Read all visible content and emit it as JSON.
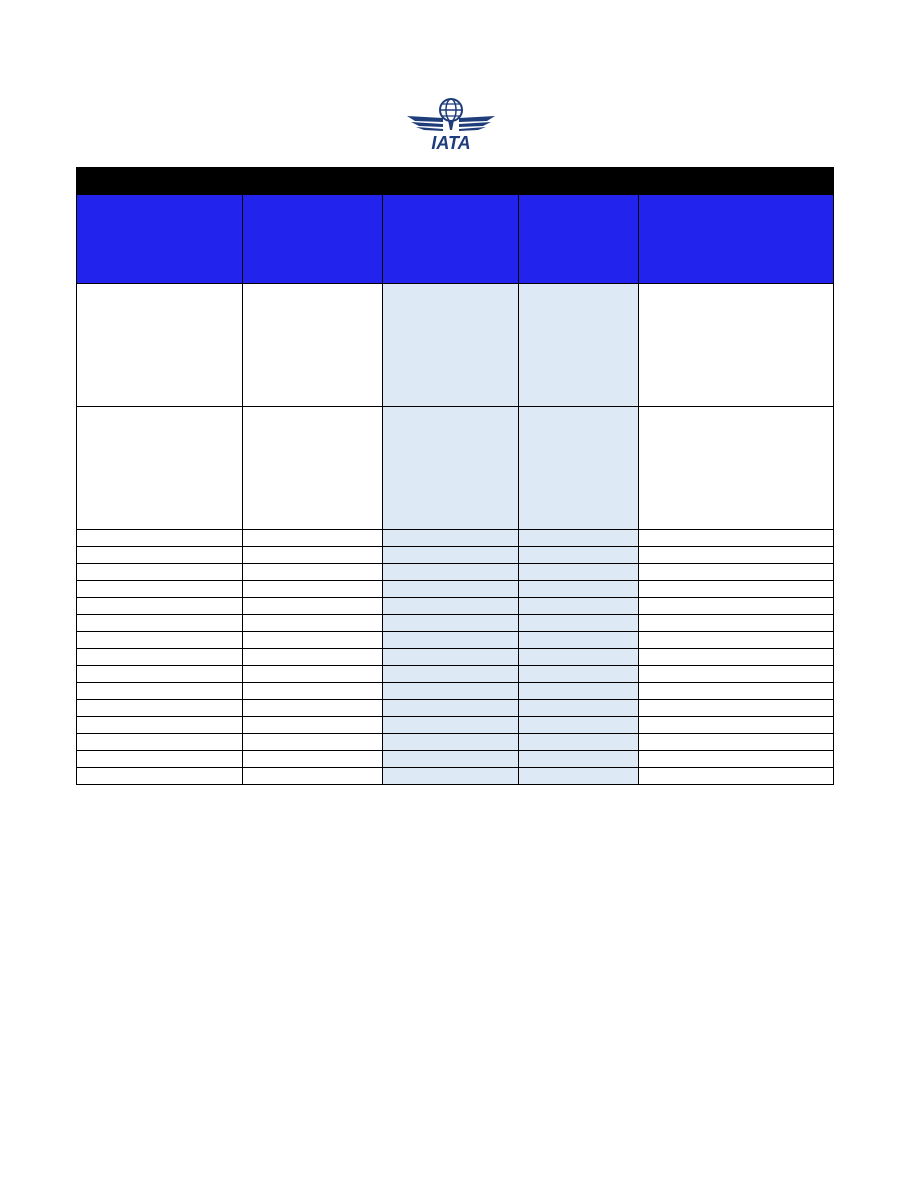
{
  "brand": {
    "logo_text": "IATA",
    "logo_color": "#1f3d7a"
  },
  "colors": {
    "title_bar": "#000000",
    "header_fill": "#2323ee",
    "shaded_fill": "#dde9f5",
    "grid_line": "#000000"
  },
  "table": {
    "title": "",
    "columns": [
      {
        "label": ""
      },
      {
        "label": ""
      },
      {
        "label": ""
      },
      {
        "label": ""
      },
      {
        "label": ""
      }
    ],
    "rows": [
      {
        "cells": [
          "",
          "",
          "",
          "",
          ""
        ]
      },
      {
        "cells": [
          "",
          "",
          "",
          "",
          ""
        ]
      },
      {
        "cells": [
          "",
          "",
          "",
          "",
          ""
        ]
      },
      {
        "cells": [
          "",
          "",
          "",
          "",
          ""
        ]
      },
      {
        "cells": [
          "",
          "",
          "",
          "",
          ""
        ]
      },
      {
        "cells": [
          "",
          "",
          "",
          "",
          ""
        ]
      },
      {
        "cells": [
          "",
          "",
          "",
          "",
          ""
        ]
      },
      {
        "cells": [
          "",
          "",
          "",
          "",
          ""
        ]
      },
      {
        "cells": [
          "",
          "",
          "",
          "",
          ""
        ]
      },
      {
        "cells": [
          "",
          "",
          "",
          "",
          ""
        ]
      },
      {
        "cells": [
          "",
          "",
          "",
          "",
          ""
        ]
      },
      {
        "cells": [
          "",
          "",
          "",
          "",
          ""
        ]
      },
      {
        "cells": [
          "",
          "",
          "",
          "",
          ""
        ]
      },
      {
        "cells": [
          "",
          "",
          "",
          "",
          ""
        ]
      },
      {
        "cells": [
          "",
          "",
          "",
          "",
          ""
        ]
      },
      {
        "cells": [
          "",
          "",
          "",
          "",
          ""
        ]
      },
      {
        "cells": [
          "",
          "",
          "",
          "",
          ""
        ]
      }
    ]
  }
}
